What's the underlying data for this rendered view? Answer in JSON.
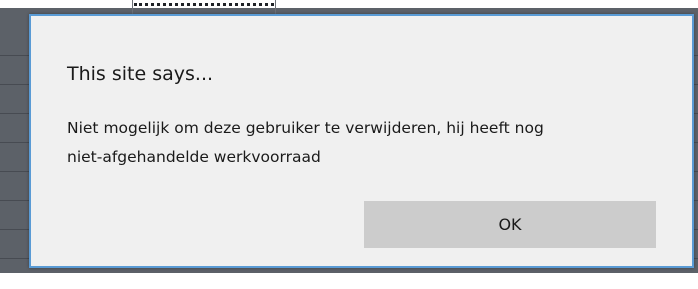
{
  "dialog": {
    "title": "This site says...",
    "message_lines": [
      "Niet mogelijk om deze gebruiker te verwijderen, hij heeft nog",
      "niet-afgehandelde werkvoorraad"
    ],
    "ok_label": "OK"
  },
  "colors": {
    "dialog_background": "#f0f0f0",
    "dialog_border": "#5a9bd5",
    "ok_button_background": "#cccccc",
    "backdrop": "#5c6168"
  }
}
